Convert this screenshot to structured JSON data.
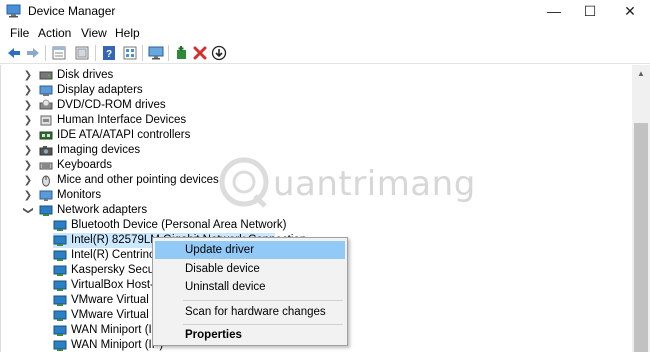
{
  "window": {
    "title": "Device Manager",
    "controls": {
      "minimize": "—",
      "maximize": "☐",
      "close": "✕"
    }
  },
  "menu": [
    "File",
    "Action",
    "View",
    "Help"
  ],
  "toolbar": {
    "icons": [
      "back-icon",
      "forward-icon",
      "properties-icon",
      "show-hidden-icon",
      "help-icon",
      "view-icon",
      "monitor-icon",
      "add-driver-icon",
      "uninstall-icon",
      "download-icon"
    ]
  },
  "tree": {
    "categories": [
      {
        "label": "Disk drives",
        "icon": "disk-drive-icon",
        "expanded": false
      },
      {
        "label": "Display adapters",
        "icon": "display-adapter-icon",
        "expanded": false
      },
      {
        "label": "DVD/CD-ROM drives",
        "icon": "dvd-drive-icon",
        "expanded": false
      },
      {
        "label": "Human Interface Devices",
        "icon": "hid-icon",
        "expanded": false
      },
      {
        "label": "IDE ATA/ATAPI controllers",
        "icon": "ide-controller-icon",
        "expanded": false
      },
      {
        "label": "Imaging devices",
        "icon": "camera-icon",
        "expanded": false
      },
      {
        "label": "Keyboards",
        "icon": "keyboard-icon",
        "expanded": false
      },
      {
        "label": "Mice and other pointing devices",
        "icon": "mouse-icon",
        "expanded": false
      },
      {
        "label": "Monitors",
        "icon": "monitor-icon",
        "expanded": false
      },
      {
        "label": "Network adapters",
        "icon": "network-adapter-icon",
        "expanded": true
      }
    ],
    "network_adapters": [
      {
        "label": "Bluetooth Device (Personal Area Network)",
        "selected": false
      },
      {
        "label": "Intel(R) 82579LM Gigabit Network Connection",
        "selected": true
      },
      {
        "label": "Intel(R) Centrino(R)",
        "selected": false
      },
      {
        "label": "Kaspersky Security",
        "selected": false
      },
      {
        "label": "VirtualBox Host-On",
        "selected": false
      },
      {
        "label": "VMware Virtual Eth",
        "selected": false
      },
      {
        "label": "VMware Virtual Eth",
        "selected": false
      },
      {
        "label": "WAN Miniport (IKE",
        "selected": false
      },
      {
        "label": "WAN Miniport (IP)",
        "selected": false
      }
    ]
  },
  "context_menu": {
    "items": [
      {
        "label": "Update driver",
        "highlighted": true,
        "bold": false
      },
      {
        "label": "Disable device",
        "highlighted": false,
        "bold": false
      },
      {
        "label": "Uninstall device",
        "highlighted": false,
        "bold": false
      },
      {
        "label": "Scan for hardware changes",
        "highlighted": false,
        "bold": false
      },
      {
        "label": "Properties",
        "highlighted": false,
        "bold": true
      }
    ]
  },
  "watermark": {
    "text": "uantrimang"
  },
  "colors": {
    "selection": "#cce8ff",
    "menu_highlight": "#91c9f7",
    "uninstall_red": "#d32f2f",
    "adapter_blue": "#2b7fc7"
  }
}
